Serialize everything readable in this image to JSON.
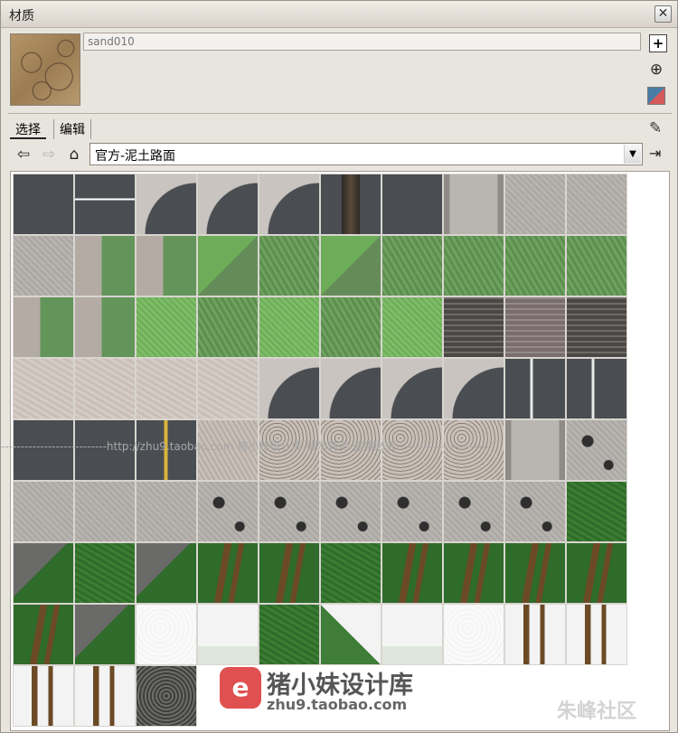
{
  "window": {
    "title": "材质",
    "close_label": "✕"
  },
  "material": {
    "name_value": "sand010"
  },
  "tabs": {
    "select": "选择",
    "edit": "编辑"
  },
  "navigation": {
    "library_value": "官方-泥土路面"
  },
  "icons": {
    "back": "back-arrow-icon",
    "forward": "forward-arrow-icon",
    "home": "home-icon",
    "eyedropper": "eyedropper-icon",
    "details": "details-icon",
    "create": "create-material-icon",
    "add": "add-to-model-icon",
    "color": "default-color-icon"
  },
  "tiles": [
    "asphalt",
    "asphalt-dash",
    "asphalt-corner",
    "asphalt-corner",
    "asphalt-corner",
    "asphalt-rail",
    "asphalt",
    "concrete-edge",
    "concrete",
    "concrete",
    "concrete",
    "grass-mix",
    "grass-mix",
    "grass-mix2",
    "grass",
    "grass-mix2",
    "grass",
    "grass",
    "grass",
    "grass",
    "grass-mix",
    "grass-mix",
    "grass-light",
    "grass",
    "grass-light",
    "grass",
    "grass-light",
    "brick",
    "brick-red",
    "brick",
    "sand",
    "sand",
    "sand",
    "sand",
    "asphalt-corner",
    "asphalt-corner",
    "asphalt-corner",
    "asphalt-corner",
    "asphalt-v",
    "asphalt-v",
    "asphalt",
    "asphalt",
    "asphalt-yellow",
    "sand-dark",
    "gravel",
    "gravel",
    "gravel",
    "gravel",
    "concrete-edge",
    "crater",
    "concrete",
    "concrete",
    "concrete",
    "crater",
    "crater",
    "crater",
    "crater",
    "crater",
    "crater",
    "dark-grass",
    "rock-grass",
    "dark-grass",
    "rock-grass",
    "track-grass",
    "track-grass",
    "dark-grass",
    "track-grass",
    "track-grass",
    "track-grass",
    "track-grass",
    "track-grass",
    "rock-grass",
    "snow",
    "snow-grass",
    "dark-grass",
    "snow-green",
    "snow-grass",
    "snow",
    "snow-track",
    "snow-track",
    "snow-track",
    "snow-track",
    "dark-rock"
  ],
  "watermark": {
    "logo": "e",
    "title": "猪小妹设计库",
    "url": "zhu9.taobao.com",
    "line": "---------------------------http://zhu9.taobao.com 猪小妹设计库 请勿转卖 盗用必究------------------------",
    "community": "朱峰社区"
  }
}
